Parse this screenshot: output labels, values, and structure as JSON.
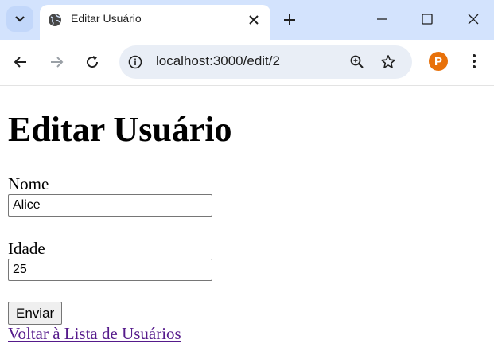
{
  "browser": {
    "tab_title": "Editar Usuário",
    "url": "localhost:3000/edit/2",
    "profile_initial": "P"
  },
  "page": {
    "heading": "Editar Usuário",
    "form": {
      "name_label": "Nome",
      "name_value": "Alice",
      "age_label": "Idade",
      "age_value": "25",
      "submit_label": "Enviar"
    },
    "back_link": "Voltar à Lista de Usuários"
  },
  "colors": {
    "tabbar": "#d3e3fd",
    "omnibox": "#e9eef6",
    "visited_link": "#551a8b",
    "profile": "#e8710a"
  }
}
